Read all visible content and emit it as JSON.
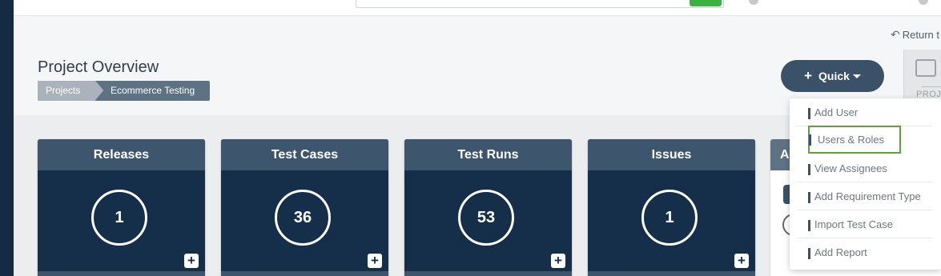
{
  "header": {
    "return_label": "Return t"
  },
  "page": {
    "title": "Project Overview",
    "breadcrumb": [
      "Projects",
      "Ecommerce Testing"
    ]
  },
  "quick": {
    "label": "Quick"
  },
  "proj_tile": {
    "label": "PROJ"
  },
  "cards": [
    {
      "title": "Releases",
      "count": "1"
    },
    {
      "title": "Test Cases",
      "count": "36"
    },
    {
      "title": "Test Runs",
      "count": "53"
    },
    {
      "title": "Issues",
      "count": "1"
    }
  ],
  "side_panel": {
    "title": "A"
  },
  "dropdown": {
    "items": [
      "Add User",
      "Users & Roles",
      "View Assignees",
      "Add Requirement Type",
      "Import Test Case",
      "Add Report"
    ],
    "active_index": 1
  },
  "colors": {
    "navy": "#152f4b",
    "card_header": "#3d566d",
    "accent_green": "#5fa336",
    "search_button": "#3cb043"
  }
}
